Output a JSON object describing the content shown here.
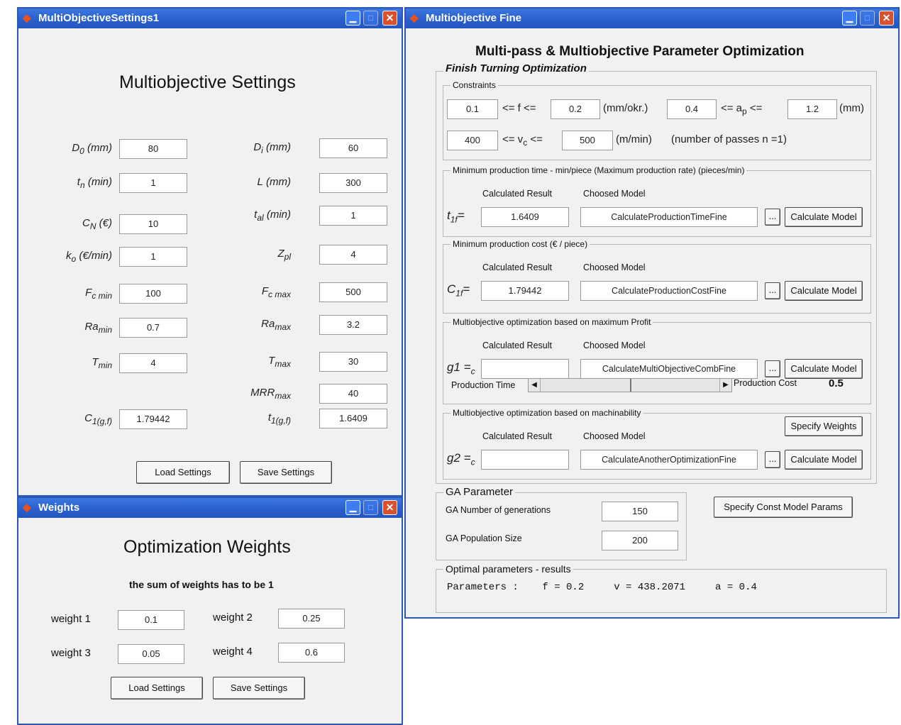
{
  "settings_window": {
    "title": "MultiObjectiveSettings1",
    "heading": "Multiobjective Settings",
    "left_fields": [
      {
        "label": "D",
        "sub": "0",
        "unit": "(mm)",
        "value": "80"
      },
      {
        "label": "t",
        "sub": "n",
        "unit": "(min)",
        "value": "1"
      },
      {
        "label": "C",
        "sub": "N",
        "unit": "(€)",
        "value": "10"
      },
      {
        "label": "k",
        "sub": "o",
        "unit": "(€/min)",
        "value": "1"
      },
      {
        "label": "F",
        "sub": "c min",
        "unit": "",
        "value": "100"
      },
      {
        "label": "Ra",
        "sub": "min",
        "unit": "",
        "value": "0.7"
      },
      {
        "label": "T",
        "sub": "min",
        "unit": "",
        "value": "4"
      },
      {
        "label": "C",
        "sub": "1(g,f)",
        "unit": "",
        "value": "1.79442"
      }
    ],
    "right_fields": [
      {
        "label": "D",
        "sub": "i",
        "unit": "(mm)",
        "value": "60"
      },
      {
        "label": "L",
        "sub": "",
        "unit": "(mm)",
        "value": "300"
      },
      {
        "label": "t",
        "sub": "al",
        "unit": "(min)",
        "value": "1"
      },
      {
        "label": "Z",
        "sub": "pl",
        "unit": "",
        "value": "4"
      },
      {
        "label": "F",
        "sub": "c max",
        "unit": "",
        "value": "500"
      },
      {
        "label": "Ra",
        "sub": "max",
        "unit": "",
        "value": "3.2"
      },
      {
        "label": "T",
        "sub": "max",
        "unit": "",
        "value": "30"
      },
      {
        "label": "MRR",
        "sub": "max",
        "unit": "",
        "value": "40"
      },
      {
        "label": "t",
        "sub": "1(g,f)",
        "unit": "",
        "value": "1.6409"
      }
    ],
    "load_label": "Load Settings",
    "save_label": "Save Settings"
  },
  "weights_window": {
    "title": "Weights",
    "heading": "Optimization Weights",
    "note": "the sum of weights has to be 1",
    "weights": [
      {
        "label": "weight 1",
        "value": "0.1"
      },
      {
        "label": "weight 2",
        "value": "0.25"
      },
      {
        "label": "weight 3",
        "value": "0.05"
      },
      {
        "label": "weight 4",
        "value": "0.6"
      }
    ],
    "load_label": "Load Settings",
    "save_label": "Save Settings"
  },
  "fine_window": {
    "title": "Multiobjective Fine",
    "heading": "Multi-pass & Multiobjective Parameter Optimization",
    "finish_legend": "Finish Turning Optimization",
    "constraints": {
      "legend": "Constraints",
      "f_min": "0.1",
      "f_op": "<= f <=",
      "f_max": "0.2",
      "f_unit": "(mm/okr.)",
      "ap_min": "0.4",
      "ap_op": "<= a",
      "ap_sub": "p",
      "ap_op2": "<=",
      "ap_max": "1.2",
      "ap_unit": "(mm)",
      "v_min": "400",
      "v_op": "<= v",
      "v_sub": "c",
      "v_op2": "<=",
      "v_max": "500",
      "v_unit": "(m/min)",
      "passes": "(number of passes n =1)"
    },
    "calc_header": "Calculated Result",
    "model_header": "Choosed Model",
    "calc_button": "Calculate Model",
    "browse_button": "...",
    "sections": [
      {
        "legend": "Minimum production time - min/piece (Maximum production rate) (pieces/min)",
        "sym": "t",
        "sub": "1f",
        "eq": "=",
        "result": "1.6409",
        "model": "CalculateProductionTimeFine"
      },
      {
        "legend": "Minimum production cost  (€ / piece)",
        "sym": "C",
        "sub": "1f",
        "eq": "=",
        "result": "1.79442",
        "model": "CalculateProductionCostFine"
      },
      {
        "legend": "Multiobjective optimization based on maximum Profit",
        "sym": "g1 =",
        "sub": "c",
        "eq": "",
        "result": "",
        "model": "CalculateMultiObjectiveCombFine"
      },
      {
        "legend": "Multiobjective optimization based on machinability",
        "sym": "g2 =",
        "sub": "c",
        "eq": "",
        "result": "",
        "model": "CalculateAnotherOptimizationFine"
      }
    ],
    "slider": {
      "left_label": "Production Time",
      "right_label": "Production Cost",
      "value": 0.5,
      "value_text": "0.5"
    },
    "specify_weights": "Specify Weights",
    "ga": {
      "legend": "GA Parameter",
      "gen_label": "GA Number of generations",
      "gen_value": "150",
      "pop_label": "GA Population Size",
      "pop_value": "200"
    },
    "specify_const": "Specify Const Model Params",
    "results": {
      "legend": "Optimal parameters - results",
      "text": "Parameters :    f = 0.2     v = 438.2071     a = 0.4"
    }
  },
  "colors": {
    "titlebar": "#2a5fcc",
    "close": "#d9502c",
    "app_icon": "#e8521c"
  }
}
